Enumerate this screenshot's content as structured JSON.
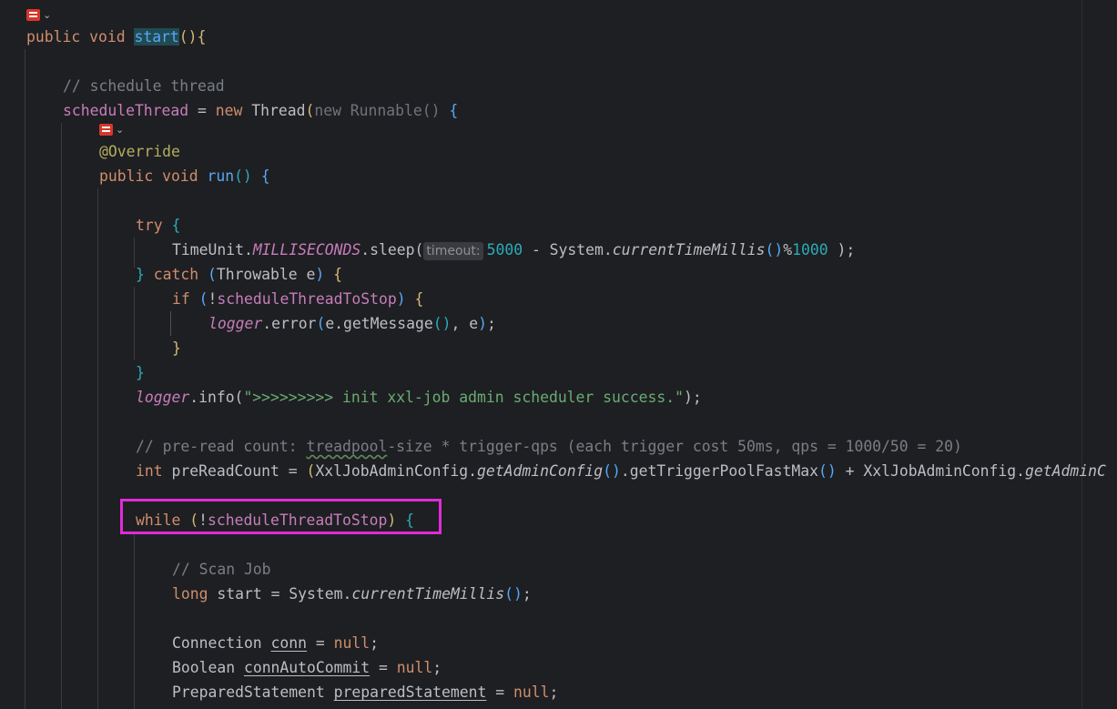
{
  "icons": {
    "gutter_marker": "implementation-marker-icon",
    "dropdown": "chevron-down-icon"
  },
  "code": {
    "l1": [
      "public",
      "void",
      "start",
      "(){"
    ],
    "l2": [
      "// schedule thread"
    ],
    "l3": [
      "scheduleThread",
      " = ",
      "new",
      " Thread",
      "(",
      "new",
      " Runnable() ",
      "{"
    ],
    "l4": [
      "@Override"
    ],
    "l5": [
      "public",
      "void",
      "run",
      "()",
      "{"
    ],
    "l6": [
      "try",
      "{"
    ],
    "l7": [
      "TimeUnit.",
      "MILLISECONDS",
      ".sleep(",
      "timeout:",
      "5000",
      " - System.",
      "currentTimeMillis",
      "()",
      "%",
      "1000",
      " );"
    ],
    "l8": [
      "}",
      " catch ",
      "(",
      "Throwable e",
      ")",
      "{"
    ],
    "l9": [
      "if",
      "(",
      "!",
      "scheduleThreadToStop",
      ")",
      "{"
    ],
    "l10": [
      "logger",
      ".error",
      "(",
      "e.getMessage",
      "()",
      ", e",
      ")",
      ";"
    ],
    "l11": [
      "}"
    ],
    "l12": [
      "}"
    ],
    "l13": [
      "logger",
      ".info(",
      "\">>>>>>>>> init xxl-job admin scheduler success.\"",
      ");"
    ],
    "l14": [
      "// pre-read count: ",
      "treadpool",
      "-size * trigger-qps (each trigger cost 50ms, qps = 1000/50 = 20)"
    ],
    "l15": [
      "int",
      "preReadCount = ",
      "(",
      "XxlJobAdminConfig.",
      "getAdminConfig",
      "()",
      ".getTriggerPoolFastMax",
      "()",
      " + XxlJobAdminConfig.",
      "getAdminC"
    ],
    "l16": [
      "while",
      "(",
      "!",
      "scheduleThreadToStop",
      ")",
      "{"
    ],
    "l17": [
      "// Scan Job"
    ],
    "l18": [
      "long",
      "start = System.",
      "currentTimeMillis",
      "()",
      ";"
    ],
    "l19": [
      "Connection ",
      "conn",
      " = ",
      "null",
      ";"
    ],
    "l20": [
      "Boolean ",
      "connAutoCommit",
      " = ",
      "null",
      ";"
    ],
    "l21": [
      "PreparedStatement ",
      "preparedStatement",
      " = ",
      "null",
      ";"
    ]
  }
}
